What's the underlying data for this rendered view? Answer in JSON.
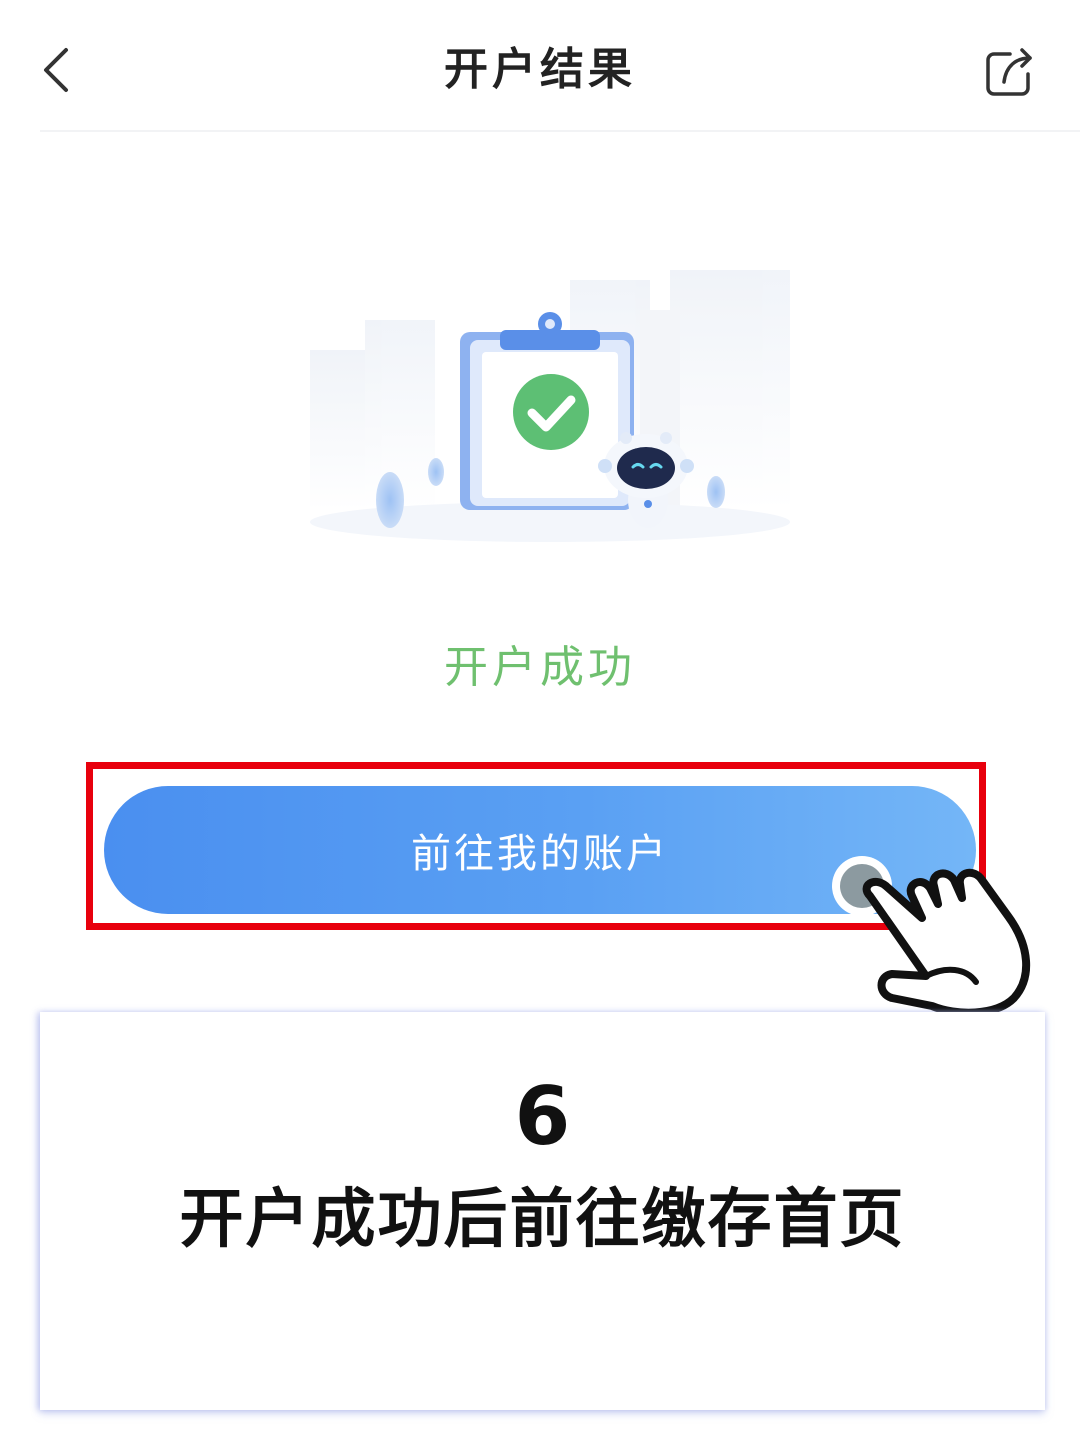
{
  "header": {
    "title": "开户结果",
    "back_icon": "chevron-left-icon",
    "share_icon": "share-icon"
  },
  "result": {
    "status_text": "开户成功",
    "illustration": "clipboard-checkmark-robot-illustration",
    "status_color": "#6fc06f"
  },
  "actions": {
    "primary_label": "前往我的账户",
    "primary_color": "#4a8ff0",
    "highlight_color": "#e8000d"
  },
  "caption": {
    "step_number": "6",
    "text": "开户成功后前往缴存首页"
  }
}
